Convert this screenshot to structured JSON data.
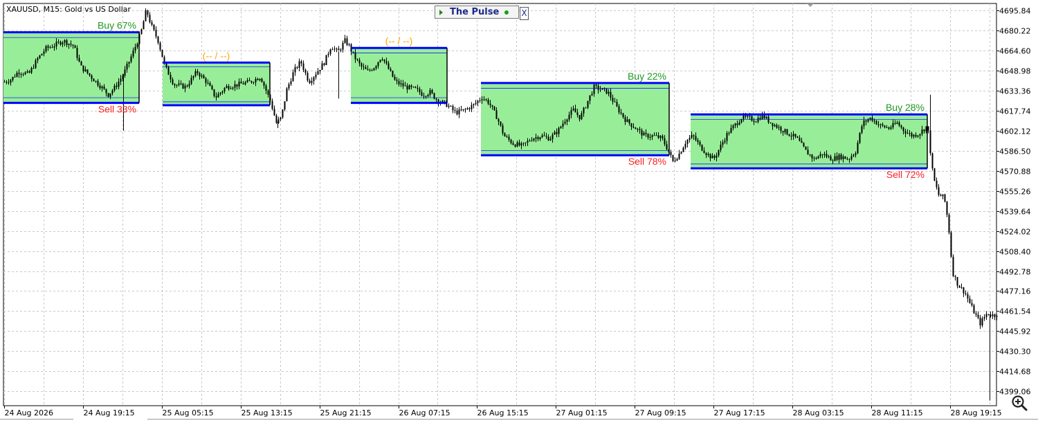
{
  "header": {
    "symbol_label": "XAUUSD, M15:  Gold vs US Dollar"
  },
  "panel": {
    "title": "The Pulse",
    "close_label": "X"
  },
  "toolbar": {
    "zoom_icon": "zoom-in-icon"
  },
  "colors": {
    "candle": "#000000",
    "zone_fill": "#98ee98",
    "zone_border": "#0000ff",
    "buy_text": "#1e9a1e",
    "sell_text": "#ff1f1f",
    "neutral_text": "#ffa500",
    "grid": "#c8c8c8"
  },
  "chart_data": {
    "type": "candlestick",
    "symbol": "XAUUSD",
    "timeframe": "M15",
    "ylim": [
      4388.0,
      4701.0
    ],
    "y_ticks": [
      "4695.84",
      "4680.22",
      "4664.60",
      "4648.98",
      "4633.36",
      "4617.74",
      "4602.12",
      "4586.50",
      "4570.88",
      "4555.26",
      "4539.64",
      "4524.02",
      "4508.40",
      "4492.78",
      "4477.16",
      "4461.54",
      "4445.92",
      "4430.30",
      "4414.68",
      "4399.06"
    ],
    "x_ticks": [
      "24 Aug 2026",
      "24 Aug 19:15",
      "25 Aug 05:15",
      "25 Aug 13:15",
      "25 Aug 21:15",
      "26 Aug 07:15",
      "26 Aug 15:15",
      "27 Aug 01:15",
      "27 Aug 09:15",
      "27 Aug 17:15",
      "28 Aug 03:15",
      "28 Aug 11:15",
      "28 Aug 19:15"
    ],
    "grid": true,
    "price_path": [
      [
        0,
        4640
      ],
      [
        10,
        4642
      ],
      [
        20,
        4648
      ],
      [
        35,
        4646
      ],
      [
        48,
        4658
      ],
      [
        60,
        4666
      ],
      [
        70,
        4668
      ],
      [
        85,
        4672
      ],
      [
        100,
        4668
      ],
      [
        110,
        4652
      ],
      [
        125,
        4644
      ],
      [
        140,
        4636
      ],
      [
        150,
        4630
      ],
      [
        160,
        4636
      ],
      [
        172,
        4646
      ],
      [
        185,
        4662
      ],
      [
        197,
        4678
      ],
      [
        205,
        4696
      ],
      [
        212,
        4684
      ],
      [
        222,
        4672
      ],
      [
        232,
        4652
      ],
      [
        245,
        4638
      ],
      [
        262,
        4636
      ],
      [
        278,
        4648
      ],
      [
        292,
        4640
      ],
      [
        305,
        4628
      ],
      [
        320,
        4636
      ],
      [
        338,
        4638
      ],
      [
        355,
        4640
      ],
      [
        370,
        4644
      ],
      [
        385,
        4624
      ],
      [
        393,
        4608
      ],
      [
        400,
        4612
      ],
      [
        408,
        4634
      ],
      [
        418,
        4648
      ],
      [
        428,
        4656
      ],
      [
        440,
        4640
      ],
      [
        452,
        4648
      ],
      [
        462,
        4655
      ],
      [
        472,
        4668
      ],
      [
        482,
        4663
      ],
      [
        492,
        4672
      ],
      [
        498,
        4668
      ],
      [
        505,
        4660
      ],
      [
        515,
        4652
      ],
      [
        525,
        4648
      ],
      [
        535,
        4652
      ],
      [
        545,
        4660
      ],
      [
        555,
        4650
      ],
      [
        565,
        4640
      ],
      [
        580,
        4636
      ],
      [
        595,
        4634
      ],
      [
        605,
        4630
      ],
      [
        615,
        4632
      ],
      [
        625,
        4626
      ],
      [
        640,
        4622
      ],
      [
        652,
        4616
      ],
      [
        665,
        4618
      ],
      [
        678,
        4622
      ],
      [
        690,
        4628
      ],
      [
        700,
        4624
      ],
      [
        712,
        4612
      ],
      [
        722,
        4598
      ],
      [
        735,
        4592
      ],
      [
        748,
        4590
      ],
      [
        762,
        4596
      ],
      [
        775,
        4598
      ],
      [
        788,
        4596
      ],
      [
        800,
        4602
      ],
      [
        812,
        4612
      ],
      [
        822,
        4618
      ],
      [
        832,
        4612
      ],
      [
        842,
        4624
      ],
      [
        852,
        4636
      ],
      [
        862,
        4634
      ],
      [
        872,
        4632
      ],
      [
        885,
        4620
      ],
      [
        898,
        4610
      ],
      [
        912,
        4604
      ],
      [
        925,
        4598
      ],
      [
        938,
        4598
      ],
      [
        950,
        4596
      ],
      [
        958,
        4588
      ],
      [
        966,
        4578
      ],
      [
        975,
        4584
      ],
      [
        985,
        4594
      ],
      [
        995,
        4598
      ],
      [
        1005,
        4590
      ],
      [
        1015,
        4584
      ],
      [
        1025,
        4580
      ],
      [
        1035,
        4590
      ],
      [
        1045,
        4600
      ],
      [
        1055,
        4606
      ],
      [
        1065,
        4612
      ],
      [
        1075,
        4612
      ],
      [
        1085,
        4610
      ],
      [
        1095,
        4614
      ],
      [
        1108,
        4608
      ],
      [
        1120,
        4604
      ],
      [
        1132,
        4600
      ],
      [
        1145,
        4596
      ],
      [
        1158,
        4586
      ],
      [
        1170,
        4580
      ],
      [
        1182,
        4584
      ],
      [
        1195,
        4580
      ],
      [
        1208,
        4582
      ],
      [
        1220,
        4580
      ],
      [
        1230,
        4586
      ],
      [
        1240,
        4608
      ],
      [
        1252,
        4612
      ],
      [
        1265,
        4606
      ],
      [
        1278,
        4604
      ],
      [
        1290,
        4608
      ],
      [
        1300,
        4602
      ],
      [
        1312,
        4598
      ],
      [
        1322,
        4600
      ],
      [
        1334,
        4606
      ],
      [
        1342,
        4566
      ],
      [
        1350,
        4552
      ],
      [
        1358,
        4550
      ],
      [
        1364,
        4530
      ],
      [
        1370,
        4492
      ],
      [
        1378,
        4482
      ],
      [
        1388,
        4476
      ],
      [
        1400,
        4462
      ],
      [
        1410,
        4452
      ],
      [
        1420,
        4460
      ],
      [
        1430,
        4458
      ],
      [
        1440,
        4462
      ]
    ],
    "zones": [
      {
        "start_index": 0,
        "end_index": 196,
        "high": 4678.6,
        "low": 4623.6,
        "inner_high": 4674.5,
        "inner_low": 4627.7,
        "label_top": "Buy 67%",
        "label_top_kind": "buy",
        "label_bottom": "Sell 33%",
        "label_bottom_kind": "sell"
      },
      {
        "start_index": 230,
        "end_index": 385,
        "high": 4655.0,
        "low": 4621.8,
        "inner_high": 4651.8,
        "inner_low": 4624.5,
        "label_top": "(-- / --)",
        "label_top_kind": "neutral",
        "label_bottom": "",
        "label_bottom_kind": "none"
      },
      {
        "start_index": 502,
        "end_index": 641,
        "high": 4666.4,
        "low": 4623.6,
        "inner_high": 4662.5,
        "inner_low": 4627.7,
        "label_top": "(-- / --)",
        "label_top_kind": "neutral",
        "label_bottom": "",
        "label_bottom_kind": "none"
      },
      {
        "start_index": 690,
        "end_index": 962,
        "high": 4639.1,
        "low": 4582.9,
        "inner_high": 4635.0,
        "inner_low": 4586.5,
        "label_top": "Buy 22%",
        "label_top_kind": "buy",
        "label_bottom": "Sell 78%",
        "label_bottom_kind": "sell"
      },
      {
        "start_index": 993,
        "end_index": 1335,
        "high": 4614.7,
        "low": 4572.7,
        "inner_high": 4610.8,
        "inner_low": 4576.1,
        "label_top": "Buy 28%",
        "label_top_kind": "buy",
        "label_bottom": "Sell 72%",
        "label_bottom_kind": "sell"
      }
    ]
  }
}
